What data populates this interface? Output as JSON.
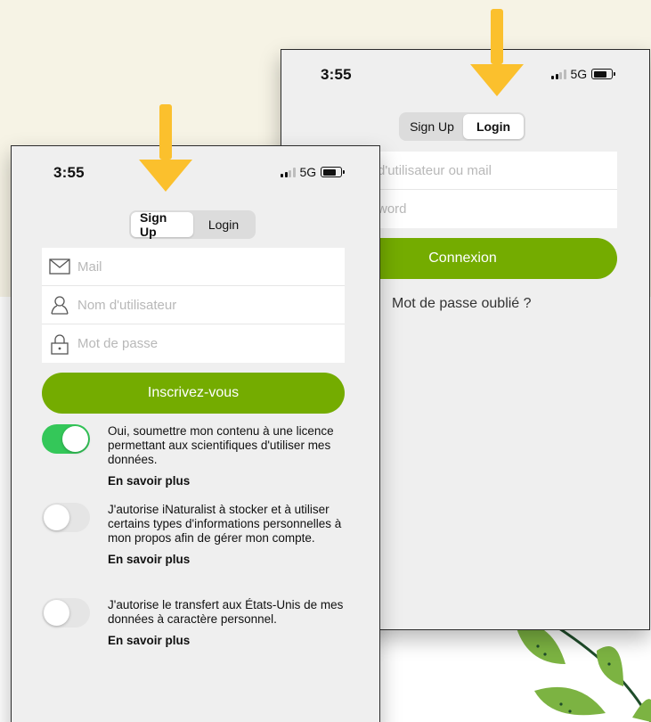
{
  "back_screen": {
    "status": {
      "time": "3:55",
      "network": "5G"
    },
    "tabs": {
      "signup": "Sign Up",
      "login": "Login",
      "active": "login"
    },
    "fields": {
      "username_placeholder": "d'utilisateur ou mail",
      "password_placeholder": "word"
    },
    "login_button": "Connexion",
    "forgot_link": "Mot de passe oublié ?"
  },
  "front_screen": {
    "status": {
      "time": "3:55",
      "network": "5G"
    },
    "tabs": {
      "signup": "Sign Up",
      "login": "Login",
      "active": "signup"
    },
    "fields": {
      "mail_placeholder": "Mail",
      "username_placeholder": "Nom d'utilisateur",
      "password_placeholder": "Mot de passe"
    },
    "signup_button": "Inscrivez-vous",
    "consents": [
      {
        "on": true,
        "text": "Oui, soumettre mon contenu à une licence permettant aux scientifiques d'utiliser mes données.",
        "link": "En savoir plus"
      },
      {
        "on": false,
        "text": "J'autorise iNaturalist à stocker et à utiliser certains types d'informations personnelles à mon propos afin de gérer mon compte.",
        "link": "En savoir plus"
      },
      {
        "on": false,
        "text": "J'autorise le transfert aux États-Unis de mes données à caractère personnel.",
        "link": "En savoir plus"
      }
    ]
  },
  "colors": {
    "brand_green": "#74ac00",
    "toggle_on": "#34c759",
    "arrow": "#fbc02d",
    "beige_bg": "#f6f3e5"
  },
  "icons": [
    "envelope-icon",
    "person-icon",
    "lock-icon",
    "signal-icon",
    "battery-icon",
    "arrow-down-icon",
    "leaf-decoration"
  ]
}
